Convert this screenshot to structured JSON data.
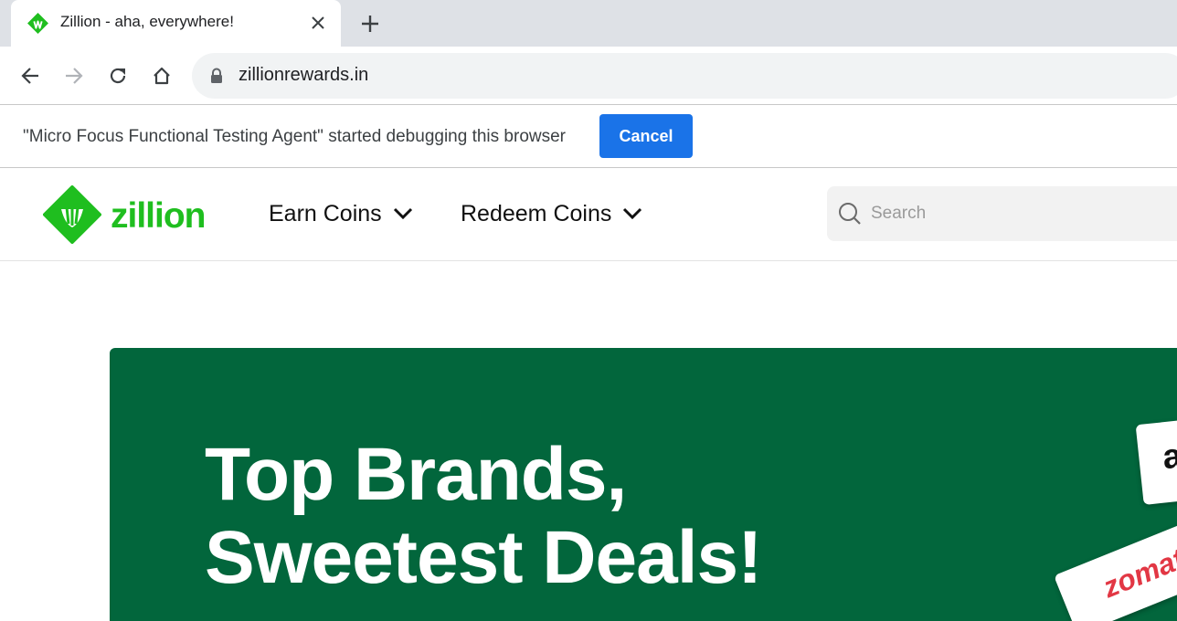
{
  "browser": {
    "tab": {
      "title": "Zillion - aha, everywhere!"
    },
    "address_bar": {
      "url": "zillionrewards.in"
    },
    "icons": [
      "back-arrow-icon",
      "forward-arrow-icon",
      "reload-icon",
      "home-icon",
      "lock-icon",
      "close-icon",
      "plus-icon"
    ]
  },
  "infobar": {
    "message": "\"Micro Focus Functional Testing Agent\" started debugging this browser",
    "cancel_label": "Cancel"
  },
  "site": {
    "logo_text": "zillion",
    "nav": [
      {
        "label": "Earn Coins"
      },
      {
        "label": "Redeem Coins"
      }
    ],
    "search": {
      "placeholder": "Search"
    },
    "banner": {
      "line1": "Top Brands,",
      "line2": "Sweetest Deals!",
      "brand_card_1": "a",
      "brand_card_2": "zomat"
    },
    "colors": {
      "brand_green": "#1fbe1f",
      "banner_green": "#02663c",
      "button_blue": "#1a73e8"
    }
  }
}
